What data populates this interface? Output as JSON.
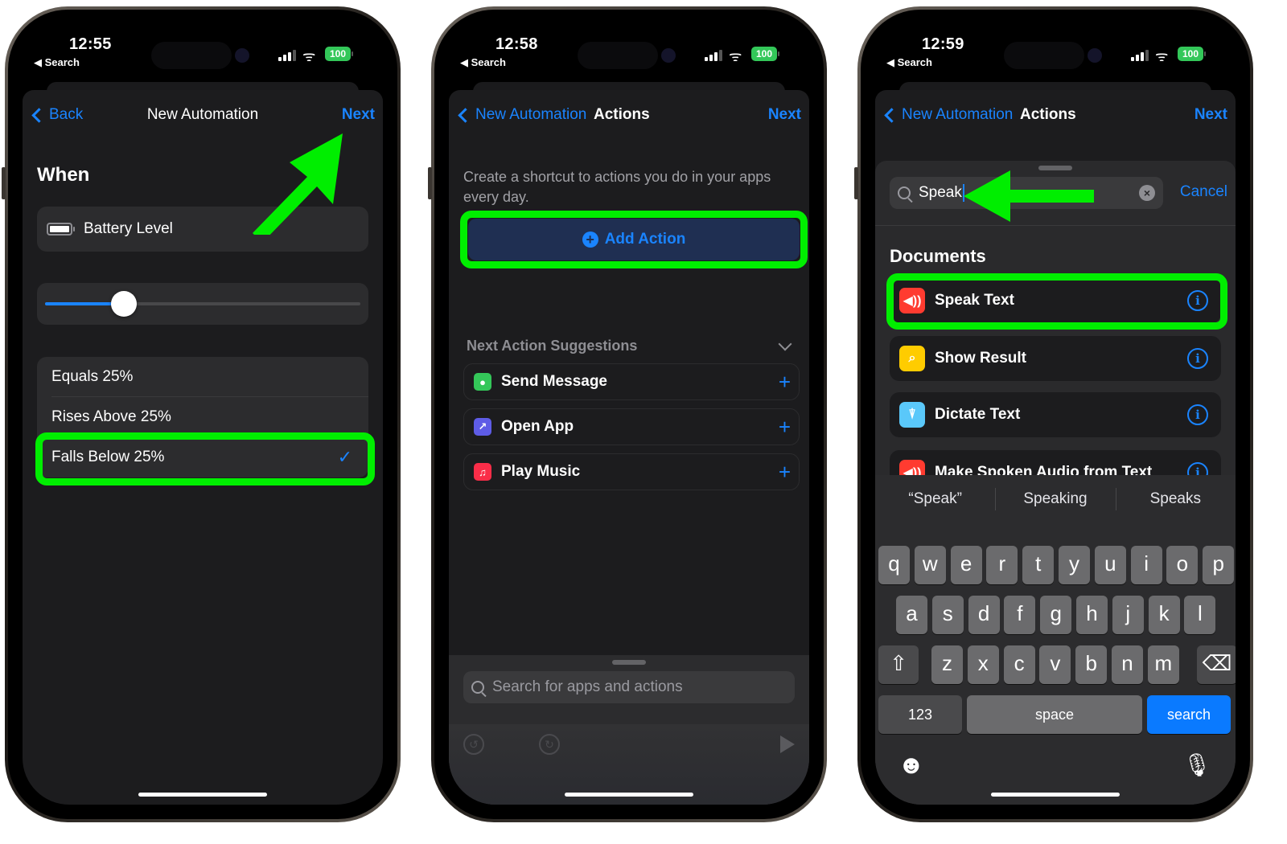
{
  "accent": "#1a84ff",
  "highlight": "#00ee00",
  "phones": [
    {
      "status": {
        "time": "12:55",
        "back_app": "◀ Search",
        "battery": "100"
      },
      "nav": {
        "back": "Back",
        "title": "New Automation",
        "next": "Next"
      },
      "when_label": "When",
      "trigger": {
        "icon": "battery-icon",
        "label": "Battery Level"
      },
      "slider": {
        "value_percent": 25
      },
      "options": [
        {
          "label": "Equals 25%",
          "selected": false
        },
        {
          "label": "Rises Above 25%",
          "selected": false
        },
        {
          "label": "Falls Below 25%",
          "selected": true
        }
      ],
      "check": "✓"
    },
    {
      "status": {
        "time": "12:58",
        "back_app": "◀ Search",
        "battery": "100"
      },
      "nav": {
        "back": "New Automation",
        "title": "Actions",
        "next": "Next"
      },
      "intro": "Create a shortcut to actions you do in your apps every day.",
      "add_action": "Add Action",
      "suggestions_title": "Next Action Suggestions",
      "suggestions": [
        {
          "label": "Send Message",
          "icon": "messages-icon",
          "color": "#34c759",
          "glyph": "💬"
        },
        {
          "label": "Open App",
          "icon": "open-app-icon",
          "color": "#5e5ce6",
          "glyph": "↗"
        },
        {
          "label": "Play Music",
          "icon": "music-icon",
          "color": "#fa2d48",
          "glyph": "♫"
        }
      ],
      "search_placeholder": "Search for apps and actions"
    },
    {
      "status": {
        "time": "12:59",
        "back_app": "◀ Search",
        "battery": "100"
      },
      "nav": {
        "back": "New Automation",
        "title": "Actions",
        "next": "Next"
      },
      "search_value": "Speak",
      "cancel": "Cancel",
      "section": "Documents",
      "results": [
        {
          "label": "Speak Text",
          "icon": "speaker-icon",
          "color": "#ff3b30",
          "glyph": "🔊"
        },
        {
          "label": "Show Result",
          "icon": "show-result-icon",
          "color": "#ffcc00",
          "glyph": "⌕"
        },
        {
          "label": "Dictate Text",
          "icon": "microphone-icon",
          "color": "#5ac8fa",
          "glyph": "🎙"
        },
        {
          "label": "Make Spoken Audio from Text",
          "icon": "speaker-icon",
          "color": "#ff3b30",
          "glyph": "🔊"
        }
      ],
      "predictions": [
        "“Speak”",
        "Speaking",
        "Speaks"
      ],
      "keyboard": {
        "row1": [
          "q",
          "w",
          "e",
          "r",
          "t",
          "y",
          "u",
          "i",
          "o",
          "p"
        ],
        "row2": [
          "a",
          "s",
          "d",
          "f",
          "g",
          "h",
          "j",
          "k",
          "l"
        ],
        "row3": [
          "z",
          "x",
          "c",
          "v",
          "b",
          "n",
          "m"
        ],
        "shift": "⇧",
        "delete": "⌫",
        "numbers": "123",
        "space": "space",
        "search": "search",
        "emoji": "☻",
        "mic": "🎙"
      }
    }
  ]
}
